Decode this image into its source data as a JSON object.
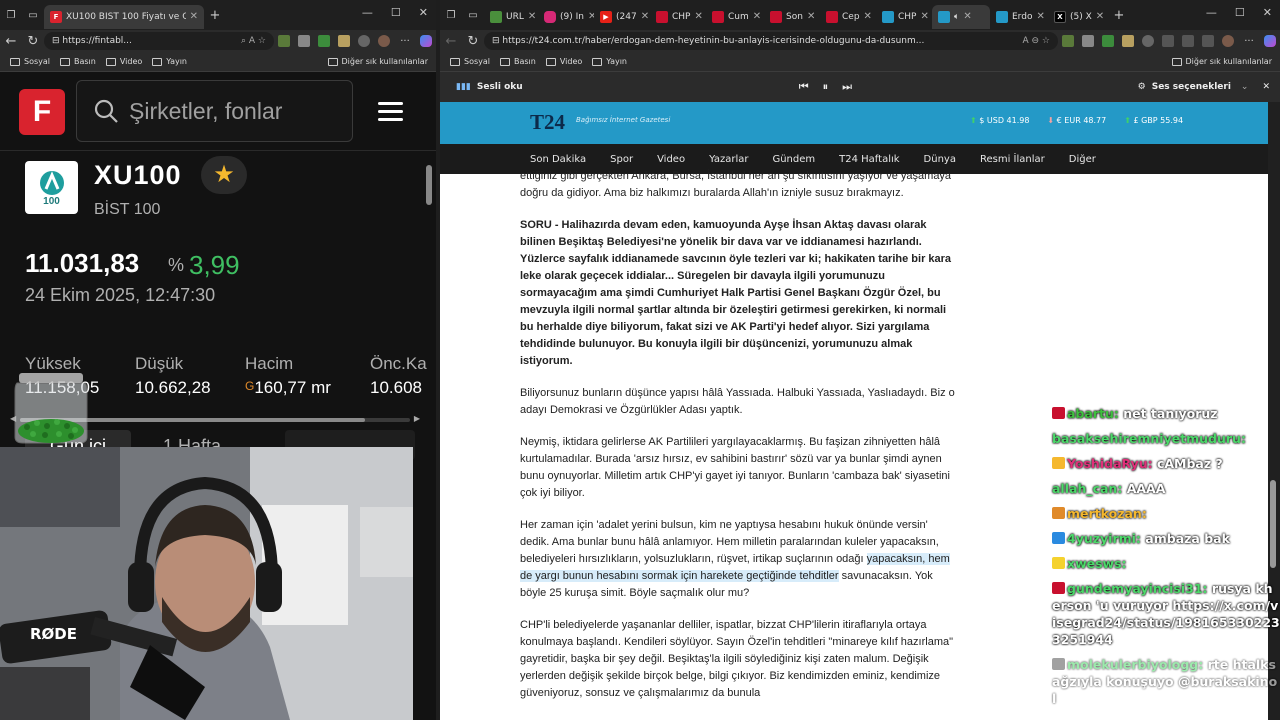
{
  "left_window": {
    "tab_title": "XU100 BİST 100 Fiyatı ve Grafikleri",
    "url": "https://fintabl...",
    "bookmarks": [
      "Sosyal",
      "Basın",
      "Video",
      "Yayın"
    ],
    "other_bookmarks": "Diğer sık kullanılanlar"
  },
  "fintables": {
    "logo_letter": "F",
    "search_placeholder": "Şirketler, fonlar",
    "symbol": "XU100",
    "index_name": "BİST 100",
    "index_logo_text": "100",
    "price": "11.031,83",
    "pct_symbol": "%",
    "pct_change": "3,99",
    "datetime": "24 Ekim 2025, 12:47:30",
    "stats": [
      {
        "label": "Yüksek",
        "value": "11.158,05"
      },
      {
        "label": "Düşük",
        "value": "10.662,28"
      },
      {
        "label": "Hacim",
        "value": "160,77 mr",
        "prefix": "G"
      },
      {
        "label": "Önc.Ka",
        "value": "10.608"
      }
    ],
    "period_tabs": [
      "Gün içi",
      "1 Hafta"
    ]
  },
  "right_window": {
    "tabs": [
      {
        "label": "URL",
        "color": "#4a8f3c"
      },
      {
        "label": "(9) In",
        "color": "#d62976"
      },
      {
        "label": "(247",
        "color": "#e62117"
      },
      {
        "label": "CHP",
        "color": "#c8102e"
      },
      {
        "label": "Cum",
        "color": "#c8102e"
      },
      {
        "label": "Son",
        "color": "#c8102e"
      },
      {
        "label": "Cep",
        "color": "#c8102e"
      },
      {
        "label": "CHP",
        "color": "#2499c7"
      },
      {
        "label": "",
        "color": "#2499c7"
      },
      {
        "label": "Erdo",
        "color": "#2499c7"
      },
      {
        "label": "(5) X",
        "color": "#000000"
      }
    ],
    "url": "https://t24.com.tr/haber/erdogan-dem-heyetinin-bu-anlayis-icerisinde-oldugunu-da-dusunm...",
    "bookmarks": [
      "Sosyal",
      "Basın",
      "Video",
      "Yayın"
    ],
    "other_bookmarks": "Diğer sık kullanılanlar",
    "read_aloud": "Sesli oku",
    "voice_options": "Ses seçenekleri"
  },
  "t24": {
    "logo": "T24",
    "tagline": "Bağımsız İnternet Gazetesi",
    "rates": [
      {
        "label": "$ USD 41.98",
        "dir": "up"
      },
      {
        "label": "€ EUR 48.77",
        "dir": "down"
      },
      {
        "label": "£ GBP 55.94",
        "dir": "up"
      }
    ],
    "nav": [
      "Son Dakika",
      "Spor",
      "Video",
      "Yazarlar",
      "Gündem",
      "T24 Haftalık",
      "Dünya",
      "Resmi İlanlar",
      "Diğer"
    ],
    "paragraphs": [
      {
        "text": "ettiğiniz gibi gerçekten Ankara, Bursa, İstanbul her an şu sıkıntısını yaşıyor ve yaşamaya doğru da gidiyor. Ama biz halkımızı buralarda Allah'ın izniyle susuz bırakmayız.",
        "bold": false
      },
      {
        "text": "SORU - Halihazırda devam eden, kamuoyunda Ayşe İhsan Aktaş davası olarak bilinen Beşiktaş Belediyesi'ne yönelik bir dava var ve iddianamesi hazırlandı. Yüzlerce sayfalık iddianamede savcının öyle tezleri var ki; hakikaten tarihe bir kara leke olarak geçecek iddialar... Süregelen bir davayla ilgili yorumunuzu sormayacağım ama şimdi Cumhuriyet Halk Partisi Genel Başkanı Özgür Özel, bu mevzuyla ilgili normal şartlar altında bir özeleştiri getirmesi gerekirken, ki normali bu herhalde diye biliyorum, fakat sizi ve AK Parti'yi hedef alıyor. Sizi yargılama tehdidinde bulunuyor. Bu konuyla ilgili bir düşüncenizi, yorumunuzu almak istiyorum.",
        "bold": true
      },
      {
        "text": "Biliyorsunuz bunların düşünce yapısı hâlâ Yassıada. Halbuki Yassıada, Yaslıadaydı. Biz o adayı Demokrasi ve Özgürlükler Adası yaptık.",
        "bold": false
      },
      {
        "text": "Neymiş, iktidara gelirlerse AK Partilileri yargılayacaklarmış. Bu faşizan zihniyetten hâlâ kurtulamadılar. Burada 'arsız hırsız, ev sahibini bastırır' sözü var ya bunlar şimdi aynen bunu oynuyorlar. Milletim artık CHP'yi gayet iyi tanıyor. Bunların 'cambaza bak' siyasetini çok iyi biliyor.",
        "bold": false
      },
      {
        "text_before": "Her zaman için 'adalet yerini bulsun, kim ne yaptıysa hesabını hukuk önünde versin' dedik. Ama bunlar bunu hâlâ anlamıyor. Hem milletin paralarından kuleler yapacaksın, belediyeleri hırsızlıkların, yolsuzlukların, rüşvet, irtikap suçlarının odağı ",
        "highlight": "yapacaksın, hem de yargı bunun hesabını sormak için harekete geçtiğinde tehditler",
        "text_after": " savunacaksın. Yok böyle 25 kuruşa simit. Böyle saçmalık olur mu?",
        "bold": false
      },
      {
        "text": "CHP'li belediyelerde yaşananlar delliler, ispatlar, bizzat CHP'lilerin itiraflarıyla ortaya konulmaya başlandı. Kendileri söylüyor. Sayın Özel'in tehditleri \"minareye kılıf hazırlama\" gayretidir, başka bir şey değil. Beşiktaş'la ilgili söylediğiniz kişi zaten malum. Değişik yerlerden değişik şekilde birçok belge, bilgi çıkıyor. Biz kendimizden eminiz, kendimize güveniyoruz, sonsuz ve çalışmalarımız da bunula",
        "bold": false
      }
    ]
  },
  "chat": [
    {
      "user": "abartu",
      "text": "net tanıyoruz",
      "color": "#3fbf3f",
      "badge": "#c8102e"
    },
    {
      "user": "basaksehiremniyetmuduru",
      "text": "",
      "color": "#4cd96a",
      "badge": ""
    },
    {
      "user": "YoshidaRyu",
      "text": "cAMbaz ?",
      "color": "#e0307a",
      "badge": "#f5b82e"
    },
    {
      "user": "allah_can",
      "text": "AAAA",
      "color": "#4cd96a",
      "badge": ""
    },
    {
      "user": "mertkozan",
      "text": "",
      "color": "#f5b82e",
      "badge": "#e08a2a"
    },
    {
      "user": "4yuzyirmi",
      "text": "ambaza bak",
      "color": "#4cd96a",
      "badge": "#2a8ae0"
    },
    {
      "user": "xwesws",
      "text": "",
      "color": "#4cd96a",
      "badge": "#f5d22e"
    },
    {
      "user": "gundemyayincisi31",
      "text": "rusya kherson 'u vuruyor https://x.com/visegrad24/status/1981653302233251944",
      "color": "#4cd96a",
      "badge": "#c8102e"
    },
    {
      "user": "molekulerbiyologg",
      "text": "rte htalks ağzıyla konuşuyo @buraksakinol",
      "color": "#4cd96a",
      "badge": "#555555",
      "faded": true
    }
  ]
}
